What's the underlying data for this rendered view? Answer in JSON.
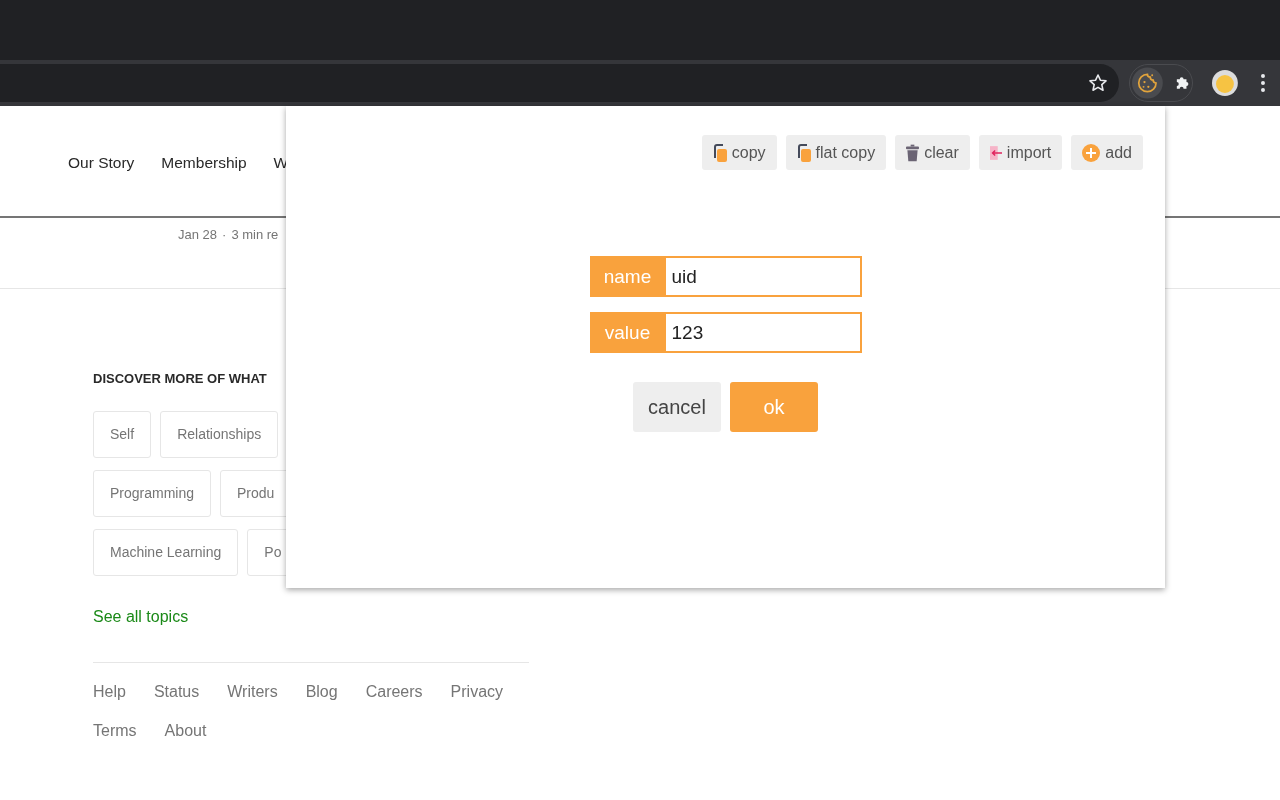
{
  "page": {
    "nav": [
      "Our Story",
      "Membership",
      "W"
    ],
    "meta": {
      "date": "Jan 28",
      "separator": "·",
      "read_time": "3 min re"
    },
    "discover_heading": "DISCOVER MORE OF WHAT",
    "topic_rows": [
      [
        "Self",
        "Relationships"
      ],
      [
        "Programming",
        "Produ"
      ],
      [
        "Machine Learning",
        "Po"
      ]
    ],
    "see_all": "See all topics",
    "footer_links": [
      [
        "Help",
        "Status",
        "Writers",
        "Blog",
        "Careers",
        "Privacy"
      ],
      [
        "Terms",
        "About"
      ]
    ]
  },
  "popup": {
    "toolbar": [
      {
        "kind": "copy",
        "label": "copy"
      },
      {
        "kind": "flat",
        "label": "flat copy"
      },
      {
        "kind": "clear",
        "label": "clear"
      },
      {
        "kind": "import",
        "label": "import"
      },
      {
        "kind": "add",
        "label": "add"
      }
    ],
    "fields": [
      {
        "label": "name",
        "value": "uid"
      },
      {
        "label": "value",
        "value": "123"
      }
    ],
    "buttons": [
      {
        "kind": "secondary",
        "label": "cancel"
      },
      {
        "kind": "primary",
        "label": "ok"
      }
    ]
  }
}
